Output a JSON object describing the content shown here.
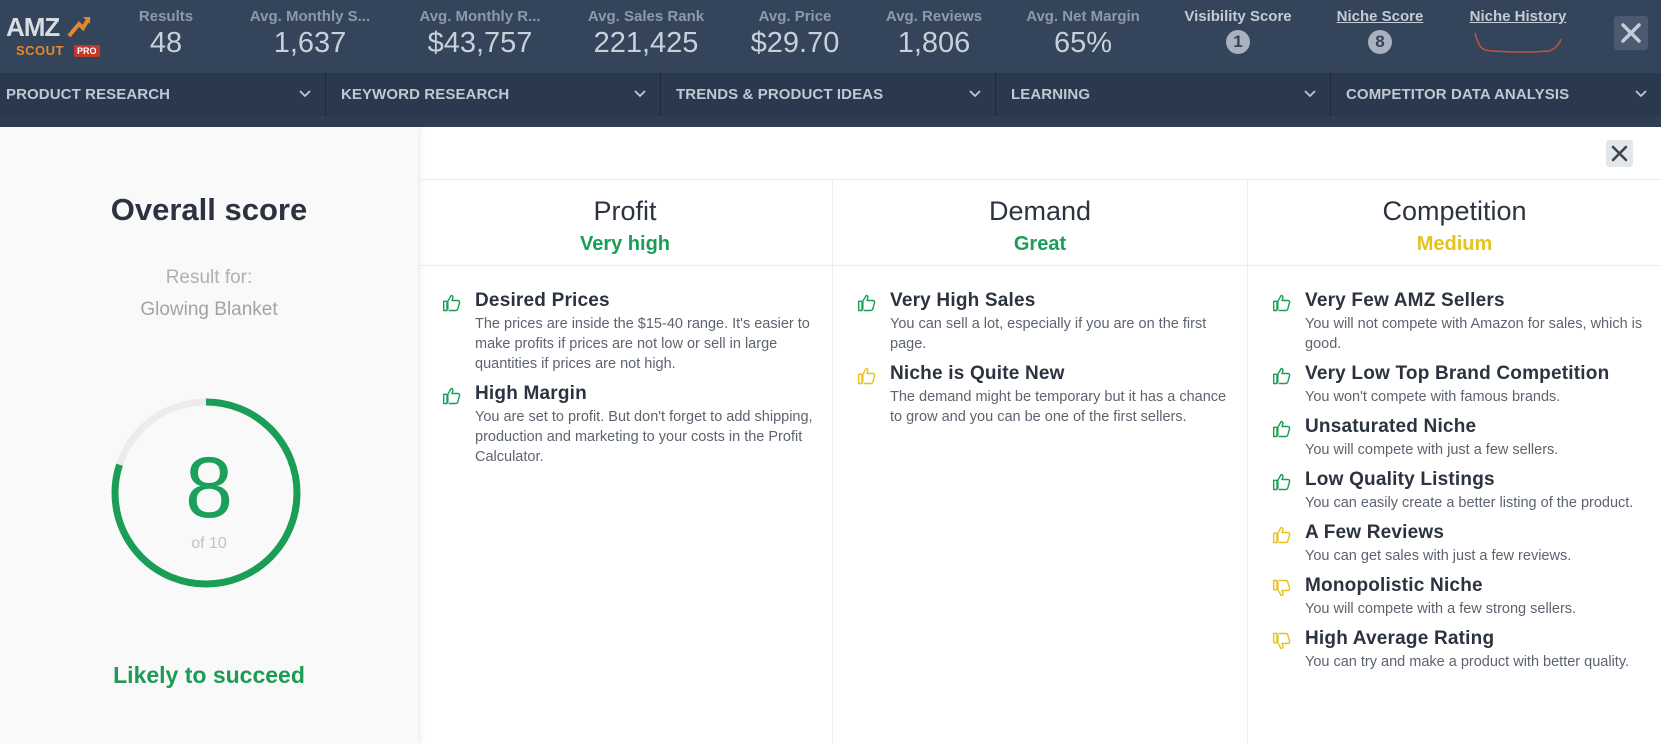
{
  "logo": {
    "line1": "AMZ",
    "line2": "SCOUT",
    "badge": "PRO"
  },
  "stats": [
    {
      "label": "Results",
      "value": "48"
    },
    {
      "label": "Avg. Monthly S...",
      "value": "1,637"
    },
    {
      "label": "Avg. Monthly R...",
      "value": "$43,757"
    },
    {
      "label": "Avg. Sales Rank",
      "value": "221,425"
    },
    {
      "label": "Avg. Price",
      "value": "$29.70"
    },
    {
      "label": "Avg. Reviews",
      "value": "1,806"
    },
    {
      "label": "Avg. Net Margin",
      "value": "65%"
    }
  ],
  "visibility_score": {
    "label": "Visibility Score",
    "value": "1"
  },
  "niche_score": {
    "label": "Niche Score",
    "value": "8"
  },
  "niche_history": {
    "label": "Niche History"
  },
  "nav": [
    "PRODUCT RESEARCH",
    "KEYWORD RESEARCH",
    "TRENDS & PRODUCT IDEAS",
    "LEARNING",
    "COMPETITOR DATA ANALYSIS"
  ],
  "overall": {
    "title": "Overall score",
    "result_for": "Result for:",
    "product": "Glowing Blanket",
    "score": "8",
    "score_of": "of 10",
    "score_fraction": 0.8,
    "verdict": "Likely to succeed"
  },
  "colors": {
    "good": "#1a9e57",
    "warn": "#e6c319",
    "navy": "#34445a"
  },
  "columns": [
    {
      "title": "Profit",
      "rating": "Very high",
      "rating_color": "#1a9e57",
      "items": [
        {
          "icon": "thumbs-up-green",
          "title": "Desired Prices",
          "desc": "The prices are inside the $15-40 range. It's easier to make profits if prices are not low or sell in large quantities if prices are not high."
        },
        {
          "icon": "thumbs-up-green",
          "title": "High Margin",
          "desc": "You are set to profit. But don't forget to add shipping, production and marketing to your costs in the Profit Calculator."
        }
      ]
    },
    {
      "title": "Demand",
      "rating": "Great",
      "rating_color": "#1a9e57",
      "items": [
        {
          "icon": "thumbs-up-green",
          "title": "Very High Sales",
          "desc": "You can sell a lot, especially if you are on the first page."
        },
        {
          "icon": "thumbs-up-yellow",
          "title": "Niche is Quite New",
          "desc": "The demand might be temporary but it has a chance to grow and you can be one of the first sellers."
        }
      ]
    },
    {
      "title": "Competition",
      "rating": "Medium",
      "rating_color": "#e6c319",
      "items": [
        {
          "icon": "thumbs-up-green",
          "title": "Very Few AMZ Sellers",
          "desc": "You will not compete with Amazon for sales, which is good."
        },
        {
          "icon": "thumbs-up-green",
          "title": "Very Low Top Brand Competition",
          "desc": "You won't compete with famous brands."
        },
        {
          "icon": "thumbs-up-green",
          "title": "Unsaturated Niche",
          "desc": "You will compete with just a few sellers."
        },
        {
          "icon": "thumbs-up-green",
          "title": "Low Quality Listings",
          "desc": "You can easily create a better listing of the product."
        },
        {
          "icon": "thumbs-up-yellow",
          "title": "A Few Reviews",
          "desc": "You can get sales with just a few reviews."
        },
        {
          "icon": "thumbs-down-yellow",
          "title": "Monopolistic Niche",
          "desc": "You will compete with a few strong sellers."
        },
        {
          "icon": "thumbs-down-yellow",
          "title": "High Average Rating",
          "desc": "You can try and make a product with better quality."
        }
      ]
    }
  ]
}
